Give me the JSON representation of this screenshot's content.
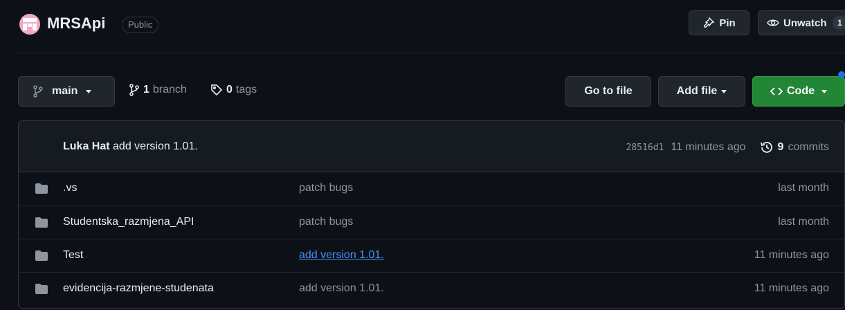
{
  "header": {
    "repo_name": "MRSApi",
    "visibility": "Public",
    "pin_label": "Pin",
    "watch_label": "Unwatch",
    "watch_count": "1"
  },
  "toolbar": {
    "branch_name": "main",
    "branch_count": "1",
    "branch_label": "branch",
    "tag_count": "0",
    "tag_label": "tags",
    "go_to_file": "Go to file",
    "add_file": "Add file",
    "code": "Code"
  },
  "commit": {
    "author": "Luka Hat",
    "message": "add version 1.01.",
    "sha": "28516d1",
    "time": "11 minutes ago",
    "commit_count": "9",
    "commit_label": "commits"
  },
  "files": [
    {
      "name": ".vs",
      "message": "patch bugs",
      "age": "last month",
      "link": false
    },
    {
      "name": "Studentska_razmjena_API",
      "message": "patch bugs",
      "age": "last month",
      "link": false
    },
    {
      "name": "Test",
      "message": "add version 1.01.",
      "age": "11 minutes ago",
      "link": true
    },
    {
      "name": "evidencija-razmjene-studenata",
      "message": "add version 1.01.",
      "age": "11 minutes ago",
      "link": false
    }
  ],
  "colors": {
    "background": "#0d1117",
    "code_button": "#238636",
    "link": "#4493f8",
    "muted_text": "#8d96a0"
  }
}
